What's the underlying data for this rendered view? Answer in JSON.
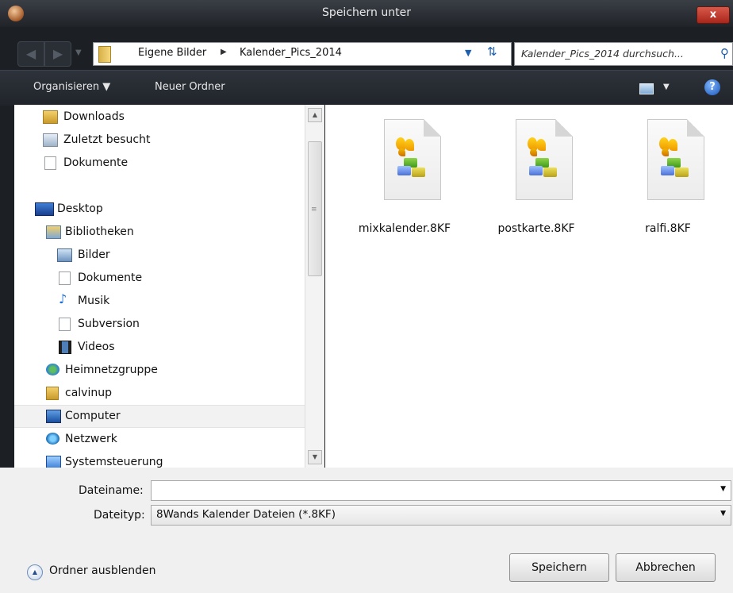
{
  "window": {
    "title": "Speichern unter",
    "close_label": "x"
  },
  "address": {
    "crumbs": [
      "Eigene Bilder",
      "Kalender_Pics_2014"
    ],
    "search_placeholder": "Kalender_Pics_2014 durchsuch..."
  },
  "toolbar": {
    "organize": "Organisieren",
    "new_folder": "Neuer Ordner",
    "help": "?"
  },
  "nav": {
    "items": [
      {
        "label": "Downloads",
        "icon": "downloads-icon"
      },
      {
        "label": "Zuletzt besucht",
        "icon": "recent-places-icon"
      },
      {
        "label": "Dokumente",
        "icon": "document-icon"
      },
      {
        "label": "Desktop",
        "icon": "desktop-icon"
      },
      {
        "label": "Bibliotheken",
        "icon": "libraries-icon"
      },
      {
        "label": "Bilder",
        "icon": "pictures-icon"
      },
      {
        "label": "Dokumente",
        "icon": "document-icon"
      },
      {
        "label": "Musik",
        "icon": "music-icon"
      },
      {
        "label": "Subversion",
        "icon": "document-icon"
      },
      {
        "label": "Videos",
        "icon": "videos-icon"
      },
      {
        "label": "Heimnetzgruppe",
        "icon": "homegroup-icon"
      },
      {
        "label": "calvinup",
        "icon": "user-folder-icon"
      },
      {
        "label": "Computer",
        "icon": "computer-icon"
      },
      {
        "label": "Netzwerk",
        "icon": "network-icon"
      },
      {
        "label": "Systemsteuerung",
        "icon": "control-panel-icon"
      }
    ]
  },
  "files": [
    {
      "name": "mixkalender.8KF"
    },
    {
      "name": "postkarte.8KF"
    },
    {
      "name": "ralfi.8KF"
    }
  ],
  "form": {
    "filename_label": "Dateiname:",
    "filename_value": "",
    "filetype_label": "Dateityp:",
    "filetype_value": "8Wands Kalender Dateien (*.8KF)"
  },
  "buttons": {
    "save": "Speichern",
    "cancel": "Abbrechen",
    "hide_folders": "Ordner ausblenden"
  }
}
